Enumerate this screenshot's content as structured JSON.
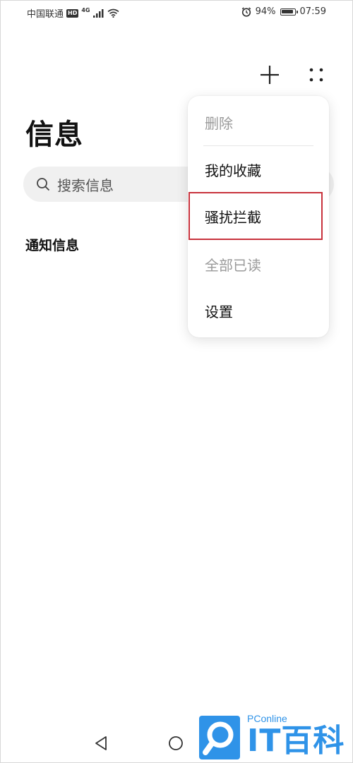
{
  "status_bar": {
    "carrier": "中国联通",
    "hd": "HD",
    "network": "4G",
    "battery": "94%",
    "battery_level": 0.94,
    "time": "07:59"
  },
  "header": {
    "add_icon": "plus-icon",
    "more_icon": "more-dots-icon",
    "title": "信息"
  },
  "search": {
    "icon": "search-icon",
    "placeholder": "搜索信息"
  },
  "section": {
    "title": "通知信息"
  },
  "menu": {
    "items": [
      {
        "label": "删除",
        "enabled": false
      },
      {
        "label": "我的收藏",
        "enabled": true
      },
      {
        "label": "骚扰拦截",
        "enabled": true,
        "highlighted": true
      },
      {
        "label": "全部已读",
        "enabled": false
      },
      {
        "label": "设置",
        "enabled": true
      }
    ],
    "highlight_color": "#c8323c"
  },
  "nav": {
    "back_icon": "back-triangle-icon",
    "home_icon": "home-circle-icon"
  },
  "watermark": {
    "brand": "PConline",
    "name": "IT百科",
    "color": "#2f93e8"
  }
}
